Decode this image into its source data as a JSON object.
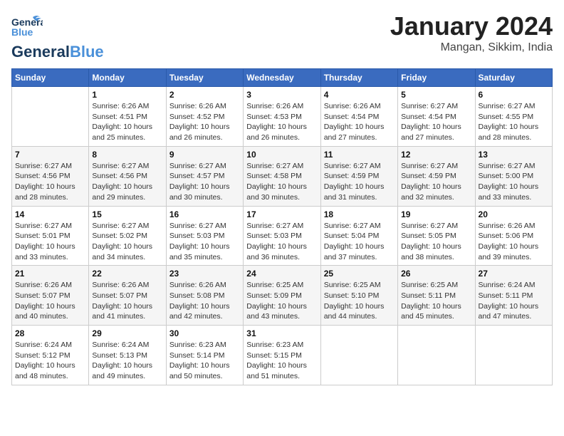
{
  "header": {
    "logo_general": "General",
    "logo_blue": "Blue",
    "month_title": "January 2024",
    "location": "Mangan, Sikkim, India"
  },
  "days_of_week": [
    "Sunday",
    "Monday",
    "Tuesday",
    "Wednesday",
    "Thursday",
    "Friday",
    "Saturday"
  ],
  "weeks": [
    [
      {
        "day": "",
        "info": ""
      },
      {
        "day": "1",
        "info": "Sunrise: 6:26 AM\nSunset: 4:51 PM\nDaylight: 10 hours\nand 25 minutes."
      },
      {
        "day": "2",
        "info": "Sunrise: 6:26 AM\nSunset: 4:52 PM\nDaylight: 10 hours\nand 26 minutes."
      },
      {
        "day": "3",
        "info": "Sunrise: 6:26 AM\nSunset: 4:53 PM\nDaylight: 10 hours\nand 26 minutes."
      },
      {
        "day": "4",
        "info": "Sunrise: 6:26 AM\nSunset: 4:54 PM\nDaylight: 10 hours\nand 27 minutes."
      },
      {
        "day": "5",
        "info": "Sunrise: 6:27 AM\nSunset: 4:54 PM\nDaylight: 10 hours\nand 27 minutes."
      },
      {
        "day": "6",
        "info": "Sunrise: 6:27 AM\nSunset: 4:55 PM\nDaylight: 10 hours\nand 28 minutes."
      }
    ],
    [
      {
        "day": "7",
        "info": "Sunrise: 6:27 AM\nSunset: 4:56 PM\nDaylight: 10 hours\nand 28 minutes."
      },
      {
        "day": "8",
        "info": "Sunrise: 6:27 AM\nSunset: 4:56 PM\nDaylight: 10 hours\nand 29 minutes."
      },
      {
        "day": "9",
        "info": "Sunrise: 6:27 AM\nSunset: 4:57 PM\nDaylight: 10 hours\nand 30 minutes."
      },
      {
        "day": "10",
        "info": "Sunrise: 6:27 AM\nSunset: 4:58 PM\nDaylight: 10 hours\nand 30 minutes."
      },
      {
        "day": "11",
        "info": "Sunrise: 6:27 AM\nSunset: 4:59 PM\nDaylight: 10 hours\nand 31 minutes."
      },
      {
        "day": "12",
        "info": "Sunrise: 6:27 AM\nSunset: 4:59 PM\nDaylight: 10 hours\nand 32 minutes."
      },
      {
        "day": "13",
        "info": "Sunrise: 6:27 AM\nSunset: 5:00 PM\nDaylight: 10 hours\nand 33 minutes."
      }
    ],
    [
      {
        "day": "14",
        "info": "Sunrise: 6:27 AM\nSunset: 5:01 PM\nDaylight: 10 hours\nand 33 minutes."
      },
      {
        "day": "15",
        "info": "Sunrise: 6:27 AM\nSunset: 5:02 PM\nDaylight: 10 hours\nand 34 minutes."
      },
      {
        "day": "16",
        "info": "Sunrise: 6:27 AM\nSunset: 5:03 PM\nDaylight: 10 hours\nand 35 minutes."
      },
      {
        "day": "17",
        "info": "Sunrise: 6:27 AM\nSunset: 5:03 PM\nDaylight: 10 hours\nand 36 minutes."
      },
      {
        "day": "18",
        "info": "Sunrise: 6:27 AM\nSunset: 5:04 PM\nDaylight: 10 hours\nand 37 minutes."
      },
      {
        "day": "19",
        "info": "Sunrise: 6:27 AM\nSunset: 5:05 PM\nDaylight: 10 hours\nand 38 minutes."
      },
      {
        "day": "20",
        "info": "Sunrise: 6:26 AM\nSunset: 5:06 PM\nDaylight: 10 hours\nand 39 minutes."
      }
    ],
    [
      {
        "day": "21",
        "info": "Sunrise: 6:26 AM\nSunset: 5:07 PM\nDaylight: 10 hours\nand 40 minutes."
      },
      {
        "day": "22",
        "info": "Sunrise: 6:26 AM\nSunset: 5:07 PM\nDaylight: 10 hours\nand 41 minutes."
      },
      {
        "day": "23",
        "info": "Sunrise: 6:26 AM\nSunset: 5:08 PM\nDaylight: 10 hours\nand 42 minutes."
      },
      {
        "day": "24",
        "info": "Sunrise: 6:25 AM\nSunset: 5:09 PM\nDaylight: 10 hours\nand 43 minutes."
      },
      {
        "day": "25",
        "info": "Sunrise: 6:25 AM\nSunset: 5:10 PM\nDaylight: 10 hours\nand 44 minutes."
      },
      {
        "day": "26",
        "info": "Sunrise: 6:25 AM\nSunset: 5:11 PM\nDaylight: 10 hours\nand 45 minutes."
      },
      {
        "day": "27",
        "info": "Sunrise: 6:24 AM\nSunset: 5:11 PM\nDaylight: 10 hours\nand 47 minutes."
      }
    ],
    [
      {
        "day": "28",
        "info": "Sunrise: 6:24 AM\nSunset: 5:12 PM\nDaylight: 10 hours\nand 48 minutes."
      },
      {
        "day": "29",
        "info": "Sunrise: 6:24 AM\nSunset: 5:13 PM\nDaylight: 10 hours\nand 49 minutes."
      },
      {
        "day": "30",
        "info": "Sunrise: 6:23 AM\nSunset: 5:14 PM\nDaylight: 10 hours\nand 50 minutes."
      },
      {
        "day": "31",
        "info": "Sunrise: 6:23 AM\nSunset: 5:15 PM\nDaylight: 10 hours\nand 51 minutes."
      },
      {
        "day": "",
        "info": ""
      },
      {
        "day": "",
        "info": ""
      },
      {
        "day": "",
        "info": ""
      }
    ]
  ]
}
